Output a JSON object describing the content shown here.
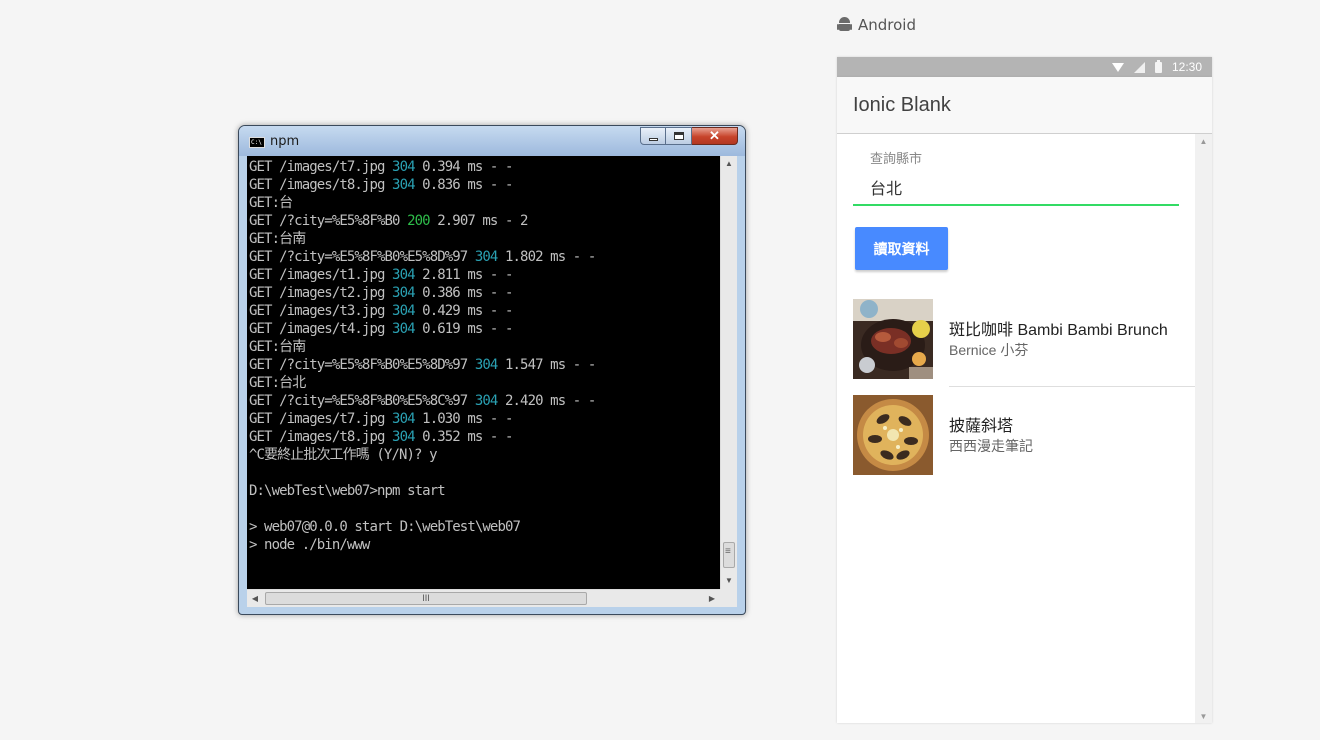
{
  "console_window": {
    "title": "npm",
    "icon": "cmd-icon",
    "buttons": {
      "minimize": "minimize-icon",
      "maximize": "maximize-icon",
      "close": "close-icon"
    },
    "lines": [
      {
        "pre": "GET /images/t7.jpg ",
        "status": "304",
        "status_color": "#2aa1b3",
        "post": " 0.394 ms - -"
      },
      {
        "pre": "GET /images/t8.jpg ",
        "status": "304",
        "status_color": "#2aa1b3",
        "post": " 0.836 ms - -"
      },
      {
        "pre": "GET:台",
        "status": "",
        "post": ""
      },
      {
        "pre": "GET /?city=%E5%8F%B0 ",
        "status": "200",
        "status_color": "#2ebd4a",
        "post": " 2.907 ms - 2"
      },
      {
        "pre": "GET:台南",
        "status": "",
        "post": ""
      },
      {
        "pre": "GET /?city=%E5%8F%B0%E5%8D%97 ",
        "status": "304",
        "status_color": "#2aa1b3",
        "post": " 1.802 ms - -"
      },
      {
        "pre": "GET /images/t1.jpg ",
        "status": "304",
        "status_color": "#2aa1b3",
        "post": " 2.811 ms - -"
      },
      {
        "pre": "GET /images/t2.jpg ",
        "status": "304",
        "status_color": "#2aa1b3",
        "post": " 0.386 ms - -"
      },
      {
        "pre": "GET /images/t3.jpg ",
        "status": "304",
        "status_color": "#2aa1b3",
        "post": " 0.429 ms - -"
      },
      {
        "pre": "GET /images/t4.jpg ",
        "status": "304",
        "status_color": "#2aa1b3",
        "post": " 0.619 ms - -"
      },
      {
        "pre": "GET:台南",
        "status": "",
        "post": ""
      },
      {
        "pre": "GET /?city=%E5%8F%B0%E5%8D%97 ",
        "status": "304",
        "status_color": "#2aa1b3",
        "post": " 1.547 ms - -"
      },
      {
        "pre": "GET:台北",
        "status": "",
        "post": ""
      },
      {
        "pre": "GET /?city=%E5%8F%B0%E5%8C%97 ",
        "status": "304",
        "status_color": "#2aa1b3",
        "post": " 2.420 ms - -"
      },
      {
        "pre": "GET /images/t7.jpg ",
        "status": "304",
        "status_color": "#2aa1b3",
        "post": " 1.030 ms - -"
      },
      {
        "pre": "GET /images/t8.jpg ",
        "status": "304",
        "status_color": "#2aa1b3",
        "post": " 0.352 ms - -"
      },
      {
        "pre": "^C要終止批次工作嗎 (Y/N)? y",
        "status": "",
        "post": ""
      },
      {
        "pre": "",
        "status": "",
        "post": ""
      },
      {
        "pre": "D:\\webTest\\web07>npm start",
        "status": "",
        "post": ""
      },
      {
        "pre": "",
        "status": "",
        "post": ""
      },
      {
        "pre": "> web07@0.0.0 start D:\\webTest\\web07",
        "status": "",
        "post": ""
      },
      {
        "pre": "> node ./bin/www",
        "status": "",
        "post": ""
      }
    ],
    "hscroll_grip": "III",
    "colors": {
      "background": "#000000",
      "text": "#c0c0c0",
      "status_304": "#2aa1b3",
      "status_200": "#2ebd4a"
    }
  },
  "platform": {
    "label": "Android",
    "icon": "android-icon"
  },
  "device": {
    "status_bar": {
      "time": "12:30",
      "icons": [
        "wifi-icon",
        "signal-icon",
        "battery-icon"
      ]
    },
    "toolbar": {
      "title": "Ionic Blank"
    },
    "form": {
      "label": "查詢縣市",
      "value": "台北",
      "button_label": "讀取資料"
    },
    "results": [
      {
        "title": "斑比咖啡 Bambi Bambi Brunch",
        "subtitle": "Bernice 小芬",
        "image": "brunch-food-photo"
      },
      {
        "title": "披薩斜塔",
        "subtitle": "西西漫走筆記",
        "image": "pizza-photo"
      }
    ],
    "colors": {
      "accent": "#488aff",
      "input_underline": "#32db64",
      "status_bar": "#b4b4b4"
    }
  }
}
